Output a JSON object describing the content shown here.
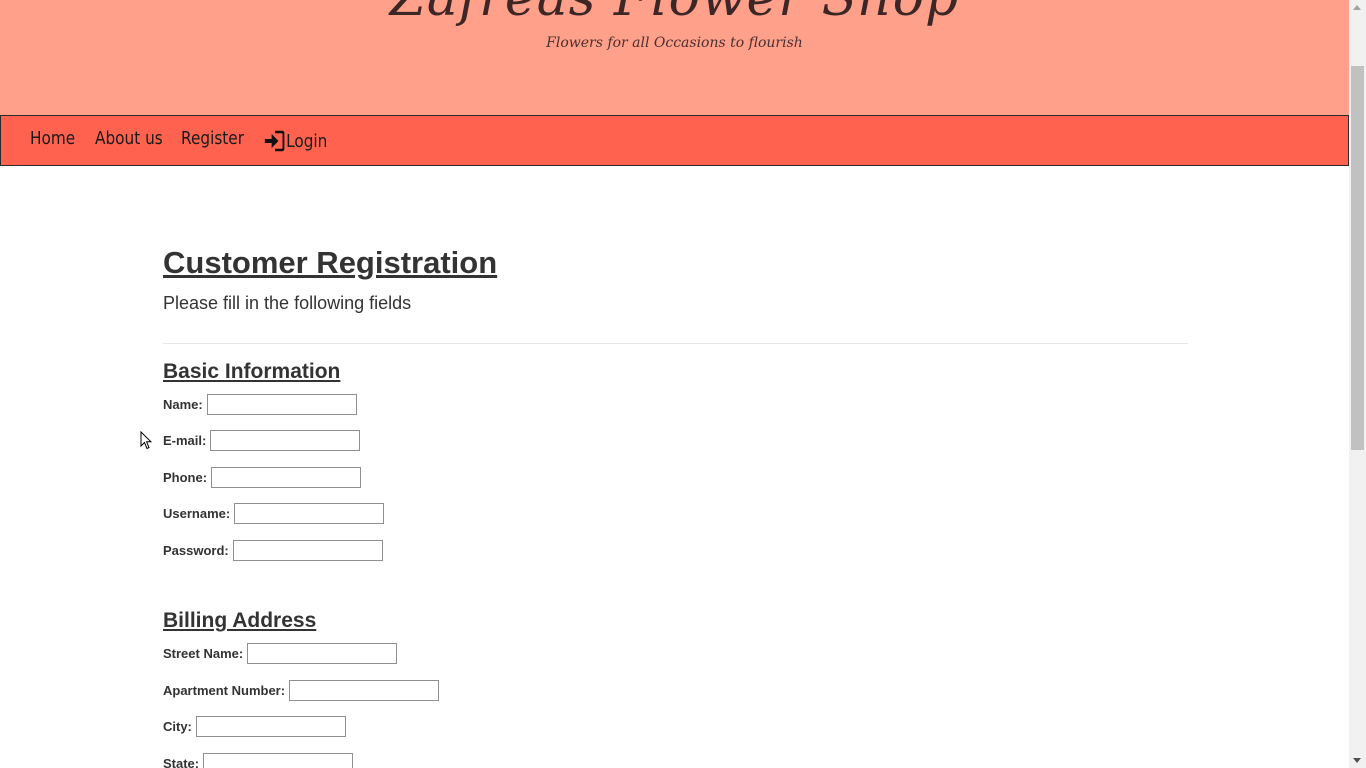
{
  "header": {
    "shop_name": "Zafreas Flower Shop",
    "tagline": "Flowers for all Occasions to flourish",
    "banner_color": "#ffa08a"
  },
  "nav": {
    "bar_color": "#ff634f",
    "items": [
      {
        "label": "Home"
      },
      {
        "label": "About us"
      },
      {
        "label": "Register"
      },
      {
        "label": "Login",
        "icon": "login-icon"
      }
    ]
  },
  "page": {
    "title": "Customer Registration",
    "subtitle": "Please fill in the following fields"
  },
  "sections": {
    "basic": {
      "title": "Basic Information",
      "fields": [
        {
          "label": "Name:",
          "value": ""
        },
        {
          "label": "E-mail:",
          "value": ""
        },
        {
          "label": "Phone:",
          "value": ""
        },
        {
          "label": "Username:",
          "value": ""
        },
        {
          "label": "Password:",
          "value": ""
        }
      ]
    },
    "billing": {
      "title": "Billing Address",
      "fields": [
        {
          "label": "Street Name:",
          "value": ""
        },
        {
          "label": "Apartment Number:",
          "value": ""
        },
        {
          "label": "City:",
          "value": ""
        },
        {
          "label": "State:",
          "value": ""
        }
      ]
    }
  }
}
